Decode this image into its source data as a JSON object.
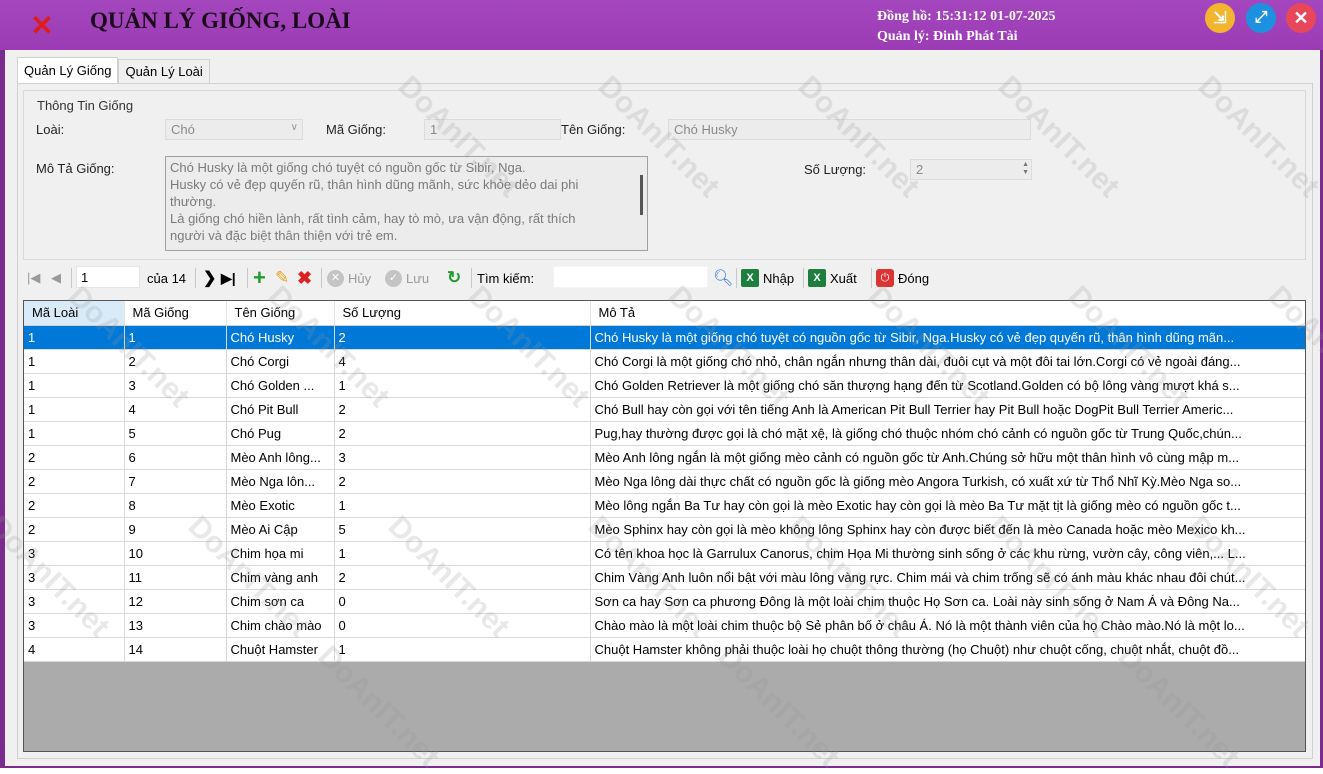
{
  "header": {
    "close_glyph": "✕",
    "title": "QUẢN LÝ GIỐNG, LOÀI",
    "clock_label": "Đồng hồ: 15:31:12 01-07-2025",
    "manager_label": "Quản lý: Đinh Phát Tài",
    "minimize_icon": "collapse-icon",
    "maximize_icon": "expand-icon",
    "close_icon": "close-icon"
  },
  "tabs": [
    {
      "label": "Quản Lý Giống",
      "active": true
    },
    {
      "label": "Quản Lý Loài",
      "active": false
    }
  ],
  "form": {
    "group_title": "Thông Tin Giống",
    "species_label": "Loài:",
    "species_value": "Chó",
    "breed_id_label": "Mã Giống:",
    "breed_id_value": "1",
    "breed_name_label": "Tên Giống:",
    "breed_name_value": "Chó Husky",
    "description_label": "Mô Tả Giống:",
    "description_lines": [
      "Chó Husky là một giống chó tuyệt có nguồn gốc từ Sibir, Nga.",
      "Husky có vẻ đẹp quyến rũ, thân hình dũng mãnh, sức khỏe dẻo dai phi",
      "thường.",
      "Là giống chó hiền lành, rất tình cảm, hay tò mò, ưa vận động, rất thích",
      "người và đặc biệt thân thiện với trẻ em."
    ],
    "quantity_label": "Số Lượng:",
    "quantity_value": "2"
  },
  "toolbar": {
    "position_value": "1",
    "of_total": "của 14",
    "cancel_label": "Hủy",
    "save_label": "Lưu",
    "search_label": "Tìm kiếm:",
    "search_value": "",
    "import_label": "Nhập",
    "export_label": "Xuất",
    "close_label": "Đóng"
  },
  "table": {
    "columns": [
      "Mã Loài",
      "Mã Giống",
      "Tên Giống",
      "Số Lượng",
      "Mô Tả"
    ],
    "rows": [
      [
        "1",
        "1",
        "Chó Husky",
        "2",
        "Chó Husky là một giống chó tuyệt có nguồn gốc từ Sibir, Nga.Husky có vẻ đẹp quyến rũ, thân hình dũng mãn..."
      ],
      [
        "1",
        "2",
        "Chó Corgi",
        "4",
        "Chó Corgi là một giống chó nhỏ, chân ngắn nhưng thân dài, đuôi cụt và một đôi tai lớn.Corgi có vẻ ngoài đáng..."
      ],
      [
        "1",
        "3",
        "Chó Golden ...",
        "1",
        "Chó Golden Retriever là một giống chó săn thượng hạng đến từ Scotland.Golden có bộ lông vàng mượt khá s..."
      ],
      [
        "1",
        "4",
        "Chó Pit Bull",
        "2",
        "Chó Bull hay còn gọi với tên tiếng Anh là American Pit Bull Terrier hay Pit Bull hoặc DogPit Bull Terrier Americ..."
      ],
      [
        "1",
        "5",
        "Chó Pug",
        "2",
        "Pug,hay thường được gọi là chó mặt xệ, là giống chó thuộc nhóm chó cảnh có nguồn gốc từ Trung Quốc,chún..."
      ],
      [
        "2",
        "6",
        "Mèo Anh lông...",
        "3",
        "Mèo Anh lông ngắn là một giống mèo cảnh có nguồn gốc từ Anh.Chúng sở hữu một thân hình vô cùng mập m..."
      ],
      [
        "2",
        "7",
        "Mèo Nga lôn...",
        "2",
        "Mèo Nga lông dài thực chất có nguồn gốc là giống mèo Angora Turkish, có xuất xứ từ Thổ Nhĩ Kỳ.Mèo Nga so..."
      ],
      [
        "2",
        "8",
        "Mèo Exotic",
        "1",
        "Mèo lông ngắn Ba Tư hay còn gọi là mèo Exotic hay còn gọi là mèo Ba Tư mặt tịt là giống mèo có nguồn gốc t..."
      ],
      [
        "2",
        "9",
        "Mèo Ai Cập",
        "5",
        "Mèo Sphinx hay còn gọi là mèo không lông Sphinx hay còn được biết đến là mèo Canada hoặc mèo Mexico kh..."
      ],
      [
        "3",
        "10",
        "Chim họa mi",
        "1",
        "Có tên khoa học là Garrulux Canorus, chim Họa Mi thường sinh sống ở các khu rừng, vườn cây, công viên,... L..."
      ],
      [
        "3",
        "11",
        "Chim vàng anh",
        "2",
        "Chim Vàng Anh luôn nổi bật với màu lông vàng rực. Chim mái và chim trống sẽ có ánh màu khác nhau đôi chút..."
      ],
      [
        "3",
        "12",
        "Chim sơn ca",
        "0",
        "Sơn ca hay Sơn ca phương Đông là một loài chim thuộc Họ Sơn ca. Loài này sinh sống ở Nam Á và Đông Na..."
      ],
      [
        "3",
        "13",
        "Chim chào mào",
        "0",
        "Chào mào là một loài chim thuộc bộ Sẻ phân bố ở châu Á. Nó là một thành viên của họ Chào mào.Nó là một lo..."
      ],
      [
        "4",
        "14",
        "Chuột Hamster",
        "1",
        "Chuột Hamster không phải thuộc loài họ chuột thông thường (họ Chuột) như chuột cống, chuột nhắt, chuột đồ..."
      ]
    ]
  },
  "watermark": "DoAnIT.net",
  "colors": {
    "header": "#a446bd",
    "selection": "#0078d7",
    "close_red": "#e01b1b"
  }
}
